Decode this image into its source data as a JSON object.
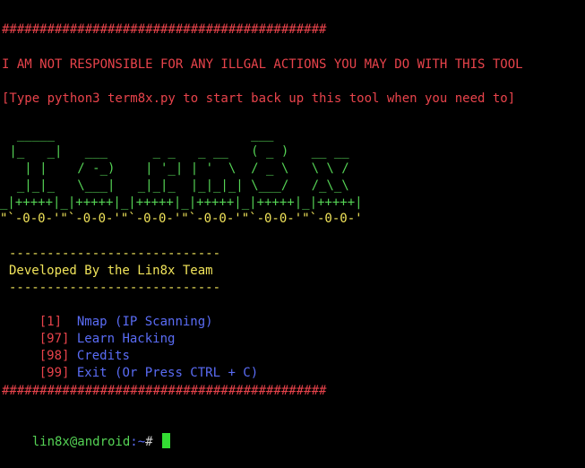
{
  "terminal": {
    "separator_top": "###########################################",
    "disclaimer": "I AM NOT RESPONSIBLE FOR ANY ILLGAL ACTIONS YOU MAY DO WITH THIS TOOL",
    "restart_hint": "[Type python3 term8x.py to start back up this tool when you need to]",
    "ascii_art": [
      "  _____                          ___",
      " |_   _|   ___      _ _   _ __   ( _ )   __ __",
      "   | |    / -_)    | '_| | '  \\  / _ \\   \\ \\ /",
      "  _|_|_   \\___|   _|_|_  |_|_|_| \\___/   /_\\_\\",
      "_|\"\"\"\"\"|_|\"\"\"\"\"|_|\"\"\"\"\"|_|\"\"\"\"\"|_|\"\"\"\"\"|_|\"\"\"\"\"|"
    ],
    "ascii_art_row5": "_|+++++|_|+++++|_|+++++|_|+++++|_|+++++|_|+++++|",
    "ascii_art_row6": "\"`-0-0-'\"`-0-0-'\"`-0-0-'\"`-0-0-'\"`-0-0-'\"`-0-0-'",
    "dash_line": "----------------------------",
    "credit": "Developed By the Lin8x Team",
    "menu": [
      {
        "num": "[1]",
        "label": "  Nmap (IP Scanning)"
      },
      {
        "num": "[97]",
        "label": " Learn Hacking"
      },
      {
        "num": "[98]",
        "label": " Credits"
      },
      {
        "num": "[99]",
        "label": " Exit (Or Press CTRL + C)"
      }
    ],
    "separator_bottom": "###########################################",
    "prompt": {
      "user_host": "lin8x@android",
      "path": ":~",
      "sign": "# "
    }
  },
  "colors": {
    "background": "#000000",
    "red": "#e8434b",
    "green": "#55d355",
    "yellow": "#f0e35a",
    "blue": "#5a6cf5",
    "cursor": "#33dd33"
  }
}
